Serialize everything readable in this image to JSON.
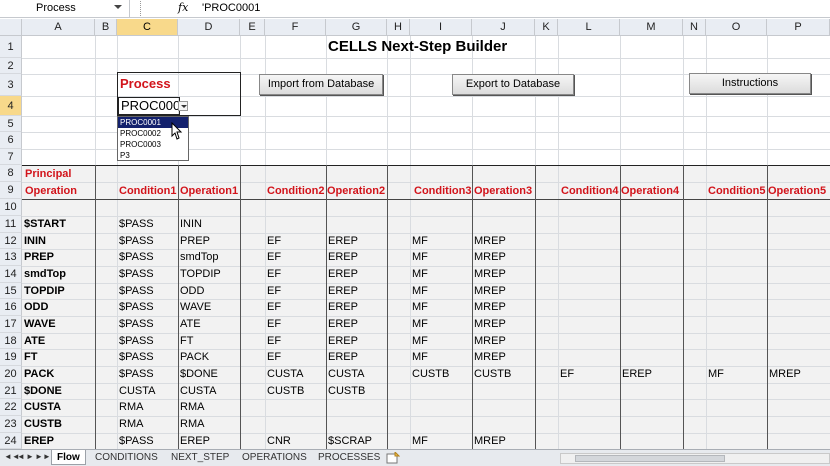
{
  "formula_bar": {
    "name_box": "Process",
    "fx_icon": "fx",
    "value": "'PROC0001"
  },
  "columns": [
    "A",
    "B",
    "C",
    "D",
    "E",
    "F",
    "G",
    "H",
    "I",
    "J",
    "K",
    "L",
    "M",
    "N",
    "O",
    "P"
  ],
  "selected_column": "C",
  "rows": [
    "1",
    "2",
    "3",
    "4",
    "5",
    "6",
    "7",
    "8",
    "9",
    "10",
    "11",
    "12",
    "13",
    "14",
    "15",
    "16",
    "17",
    "18",
    "19",
    "20",
    "21",
    "22",
    "23",
    "24"
  ],
  "selected_row": "4",
  "sheet": {
    "title": "CELLS Next-Step Builder",
    "process_label": "Process",
    "process_value": "PROC000",
    "buttons": {
      "import": "Import from Database",
      "export": "Export to Database",
      "instructions": "Instructions"
    },
    "dropdown": {
      "options": [
        "PROC0001",
        "PROC0002",
        "PROC0003",
        "P3"
      ],
      "highlighted": "PROC0001"
    },
    "headers": {
      "principal_line1": "Principal",
      "principal_line2": "Operation",
      "condition1": "Condition1",
      "operation1": "Operation1",
      "condition2": "Condition2",
      "operation2": "Operation2",
      "condition3": "Condition3",
      "operation3": "Operation3",
      "condition4": "Condition4",
      "operation4": "Operation4",
      "condition5": "Condition5",
      "operation5": "Operation5"
    },
    "data_rows": [
      {
        "row": "11",
        "a": "$START",
        "c": "$PASS",
        "d": "ININ",
        "f": "",
        "g": "",
        "i": "",
        "j": "",
        "l": "",
        "m": "",
        "o": "",
        "p": ""
      },
      {
        "row": "12",
        "a": "ININ",
        "c": "$PASS",
        "d": "PREP",
        "f": "EF",
        "g": "EREP",
        "i": "MF",
        "j": "MREP",
        "l": "",
        "m": "",
        "o": "",
        "p": ""
      },
      {
        "row": "13",
        "a": "PREP",
        "c": "$PASS",
        "d": "smdTop",
        "f": "EF",
        "g": "EREP",
        "i": "MF",
        "j": "MREP",
        "l": "",
        "m": "",
        "o": "",
        "p": ""
      },
      {
        "row": "14",
        "a": "smdTop",
        "c": "$PASS",
        "d": "TOPDIP",
        "f": "EF",
        "g": "EREP",
        "i": "MF",
        "j": "MREP",
        "l": "",
        "m": "",
        "o": "",
        "p": ""
      },
      {
        "row": "15",
        "a": "TOPDIP",
        "c": "$PASS",
        "d": "ODD",
        "f": "EF",
        "g": "EREP",
        "i": "MF",
        "j": "MREP",
        "l": "",
        "m": "",
        "o": "",
        "p": ""
      },
      {
        "row": "16",
        "a": "ODD",
        "c": "$PASS",
        "d": "WAVE",
        "f": "EF",
        "g": "EREP",
        "i": "MF",
        "j": "MREP",
        "l": "",
        "m": "",
        "o": "",
        "p": ""
      },
      {
        "row": "17",
        "a": "WAVE",
        "c": "$PASS",
        "d": "ATE",
        "f": "EF",
        "g": "EREP",
        "i": "MF",
        "j": "MREP",
        "l": "",
        "m": "",
        "o": "",
        "p": ""
      },
      {
        "row": "18",
        "a": "ATE",
        "c": "$PASS",
        "d": "FT",
        "f": "EF",
        "g": "EREP",
        "i": "MF",
        "j": "MREP",
        "l": "",
        "m": "",
        "o": "",
        "p": ""
      },
      {
        "row": "19",
        "a": "FT",
        "c": "$PASS",
        "d": "PACK",
        "f": "EF",
        "g": "EREP",
        "i": "MF",
        "j": "MREP",
        "l": "",
        "m": "",
        "o": "",
        "p": ""
      },
      {
        "row": "20",
        "a": "PACK",
        "c": "$PASS",
        "d": "$DONE",
        "f": "CUSTA",
        "g": "CUSTA",
        "i": "CUSTB",
        "j": "CUSTB",
        "l": "EF",
        "m": "EREP",
        "o": "MF",
        "p": "MREP"
      },
      {
        "row": "21",
        "a": "$DONE",
        "c": "CUSTA",
        "d": "CUSTA",
        "f": "CUSTB",
        "g": "CUSTB",
        "i": "",
        "j": "",
        "l": "",
        "m": "",
        "o": "",
        "p": ""
      },
      {
        "row": "22",
        "a": "CUSTA",
        "c": "RMA",
        "d": "RMA",
        "f": "",
        "g": "",
        "i": "",
        "j": "",
        "l": "",
        "m": "",
        "o": "",
        "p": ""
      },
      {
        "row": "23",
        "a": "CUSTB",
        "c": "RMA",
        "d": "RMA",
        "f": "",
        "g": "",
        "i": "",
        "j": "",
        "l": "",
        "m": "",
        "o": "",
        "p": ""
      },
      {
        "row": "24",
        "a": "EREP",
        "c": "$PASS",
        "d": "EREP",
        "f": "CNR",
        "g": "$SCRAP",
        "i": "MF",
        "j": "MREP",
        "l": "",
        "m": "",
        "o": "",
        "p": ""
      }
    ]
  },
  "tabs": [
    "Flow",
    "CONDITIONS",
    "NEXT_STEP",
    "OPERATIONS",
    "PROCESSES"
  ],
  "active_tab": "Flow",
  "tab_nav": [
    "◄◄",
    "◄",
    "►",
    "►►"
  ]
}
